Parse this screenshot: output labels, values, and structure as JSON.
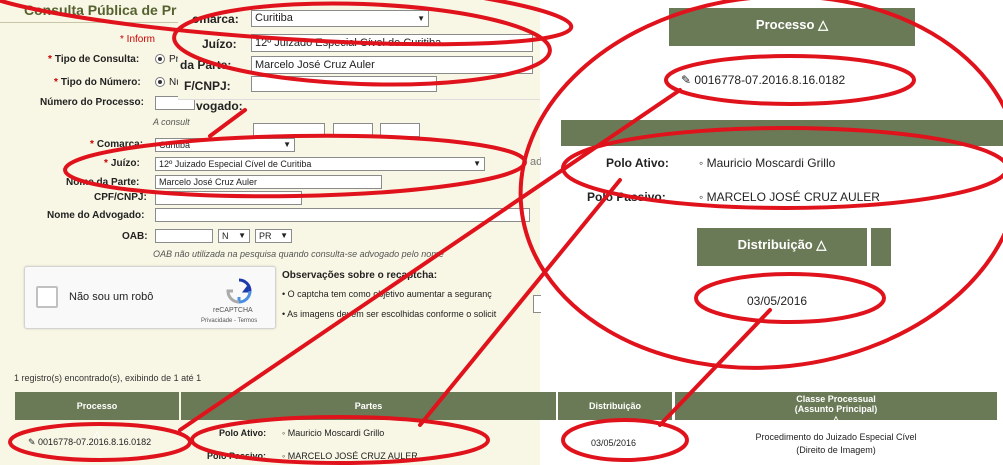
{
  "form": {
    "title": "Consulta Pública de Pr",
    "info_fragment": "* Inform",
    "tipo_consulta": {
      "label": "Tipo de Consulta:",
      "option": "Proc"
    },
    "tipo_numero": {
      "label": "Tipo do Número:",
      "option": "Núme"
    },
    "numero_processo": {
      "label": "Número do Processo:",
      "hint": "A consult"
    },
    "comarca": {
      "label": "Comarca:",
      "value": "Curitiba"
    },
    "juizo": {
      "label": "Juízo:",
      "value": "12º Juizado Especial Cível de Curitiba"
    },
    "nome_parte": {
      "label": "Nome da Parte:",
      "value": "Marcelo José Cruz Auler"
    },
    "cpf_cnpj": {
      "label": "CPF/CNPJ:"
    },
    "nome_advogado": {
      "label": "Nome do Advogado:"
    },
    "oab": {
      "label": "OAB:",
      "type_value": "N",
      "uf_value": "PR",
      "hint": "OAB não utilizada na pesquisa quando consulta-se advogado pelo nome"
    },
    "captcha": {
      "label": "Não sou um robô",
      "brand": "reCAPTCHA",
      "links": "Privacidade - Termos"
    },
    "observacoes": {
      "title": "Observações sobre o recaptcha:",
      "items": [
        "O captcha tem como objetivo aumentar a seguranç",
        "As imagens devem ser escolhidas conforme o solicit"
      ]
    },
    "side_fragment": "ado"
  },
  "results": {
    "count_text": "1 registro(s) encontrado(s), exibindo de 1 até 1",
    "headers": {
      "processo": "Processo",
      "partes": "Partes",
      "distribuicao": "Distribuição",
      "classe_line1": "Classe Processual",
      "classe_line2": "(Assunto Principal)"
    },
    "row": {
      "processo": "0016778-07.2016.8.16.0182",
      "polo_ativo_label": "Polo Ativo:",
      "polo_ativo": "Mauricio Moscardi Grillo",
      "polo_passivo_label": "Polo Passivo:",
      "polo_passivo": "MARCELO JOSÉ CRUZ AULER",
      "distribuicao": "03/05/2016",
      "classe_line1": "Procedimento do Juizado Especial Cível",
      "classe_line2": "(Direito de Imagem)"
    }
  },
  "zoom_form": {
    "comarca_frag": "omarca:",
    "comarca_value": "Curitiba",
    "juizo_label": "Juízo:",
    "juizo_value": "12º Juizado Especial Cível de Curitiba",
    "parte_frag": "da Parte:",
    "parte_value": "Marcelo José Cruz Auler",
    "cpf_frag": "F/CNPJ:",
    "advogado_frag": "vogado:"
  },
  "zoom_right": {
    "processo_header": "Processo",
    "processo_value": "0016778-07.2016.8.16.0182",
    "polo_ativo_label": "Polo Ativo:",
    "polo_ativo_value": "Mauricio Moscardi Grillo",
    "polo_passivo_label": "Polo Passivo:",
    "polo_passivo_value": "MARCELO JOSÉ CRUZ AULER",
    "distribuicao_header": "Distribuição",
    "distribuicao_value": "03/05/2016"
  },
  "colors": {
    "header_bg": "#6b7a56",
    "form_bg": "#f8f6e4",
    "annotation": "#e0121b",
    "required": "#cc0000"
  }
}
